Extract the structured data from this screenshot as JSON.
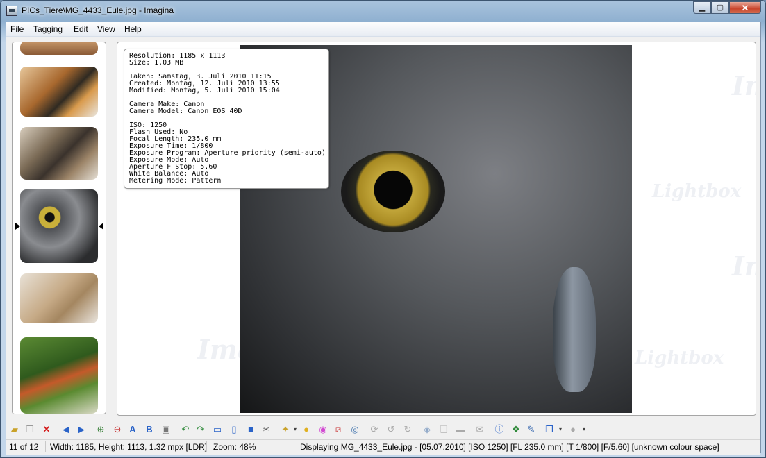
{
  "window": {
    "title": "PICs_Tiere\\MG_4433_Eule.jpg - Imagina"
  },
  "menu": [
    "File",
    "Tagging",
    "Edit",
    "View",
    "Help"
  ],
  "watermark": {
    "brand": "Imagina",
    "sub": "Lightbox"
  },
  "exif": {
    "resolution": "Resolution: 1185 x 1113",
    "size": "Size: 1.03 MB",
    "taken": "Taken: Samstag, 3. Juli 2010 11:15",
    "created": "Created: Montag, 12. Juli 2010 13:55",
    "modified": "Modified: Montag, 5. Juli 2010 15:04",
    "camera_make": "Camera Make: Canon",
    "camera_model": "Camera Model: Canon EOS 40D",
    "iso": "ISO: 1250",
    "flash": "Flash Used: No",
    "focal_length": "Focal Length: 235.0 mm",
    "exposure_time": "Exposure Time: 1/800",
    "exposure_program": "Exposure Program: Aperture priority (semi-auto)",
    "exposure_mode": "Exposure Mode: Auto",
    "aperture": "Aperture F Stop: 5.60",
    "white_balance": "White Balance: Auto",
    "metering": "Metering Mode: Pattern"
  },
  "status": {
    "position": "11 of 12",
    "dimensions": "Width: 1185, Height: 1113, 1.32 mpx [LDR]",
    "zoom": "Zoom: 48%",
    "info": "Displaying MG_4433_Eule.jpg - [05.07.2010]  [ISO 1250]  [FL 235.0 mm]  [T 1/800]  [F/5.60]  [unknown colour space]"
  },
  "colors": {
    "accent": "#3d5570",
    "close": "#c8442b",
    "selection_arrow": "#000000"
  }
}
